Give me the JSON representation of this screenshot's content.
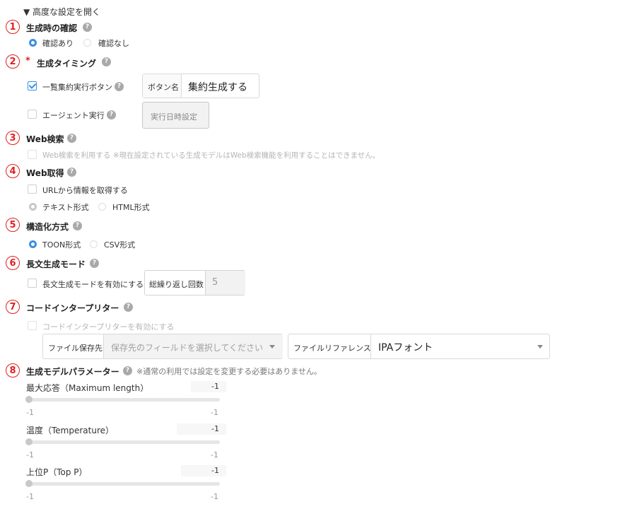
{
  "advanced_toggle": "▼ 高度な設定を開く",
  "help_glyph": "?",
  "required_mark": "*",
  "numbers": [
    "1",
    "2",
    "3",
    "4",
    "5",
    "6",
    "7",
    "8"
  ],
  "confirm": {
    "title": "生成時の確認",
    "options": [
      "確認あり",
      "確認なし"
    ],
    "selected": "確認あり"
  },
  "timing": {
    "title": "生成タイミング",
    "batch_label": "一覧集約実行ボタン",
    "batch_checked": true,
    "button_name_label": "ボタン名",
    "button_name_value": "集約生成する",
    "agent_label": "エージェント実行",
    "agent_checked": false,
    "schedule_button": "実行日時設定"
  },
  "web_search": {
    "title": "Web検索",
    "checkbox_label": "Web検索を利用する ※現在設定されている生成モデルはWeb検索機能を利用することはできません。"
  },
  "web_fetch": {
    "title": "Web取得",
    "checkbox_label": "URLから情報を取得する",
    "options": [
      "テキスト形式",
      "HTML形式"
    ],
    "selected": "テキスト形式"
  },
  "structure": {
    "title": "構造化方式",
    "options": [
      "TOON形式",
      "CSV形式"
    ],
    "selected": "TOON形式"
  },
  "long_mode": {
    "title": "長文生成モード",
    "checkbox_label": "長文生成モードを有効にする",
    "repeat_label": "総繰り返し回数",
    "repeat_value": "5"
  },
  "code_interpreter": {
    "title": "コードインタープリター",
    "checkbox_label": "コードインタープリターを有効にする",
    "save_label": "ファイル保存先",
    "save_placeholder": "保存先のフィールドを選択してください",
    "ref_label": "ファイルリファレンス",
    "ref_value": "IPAフォント"
  },
  "params": {
    "title": "生成モデルパラメーター",
    "note": "※通常の利用では設定を変更する必要はありません。",
    "sliders": [
      {
        "label": "最大応答（Maximum length）",
        "value": "-1",
        "min": "-1",
        "max": "-1"
      },
      {
        "label": "温度（Temperature）",
        "value": "-1",
        "min": "-1",
        "max": "-1"
      },
      {
        "label": "上位P（Top P）",
        "value": "-1",
        "min": "-1",
        "max": "-1"
      }
    ]
  },
  "colors": {
    "accent": "#3a8ee6",
    "number": "#e02020"
  }
}
